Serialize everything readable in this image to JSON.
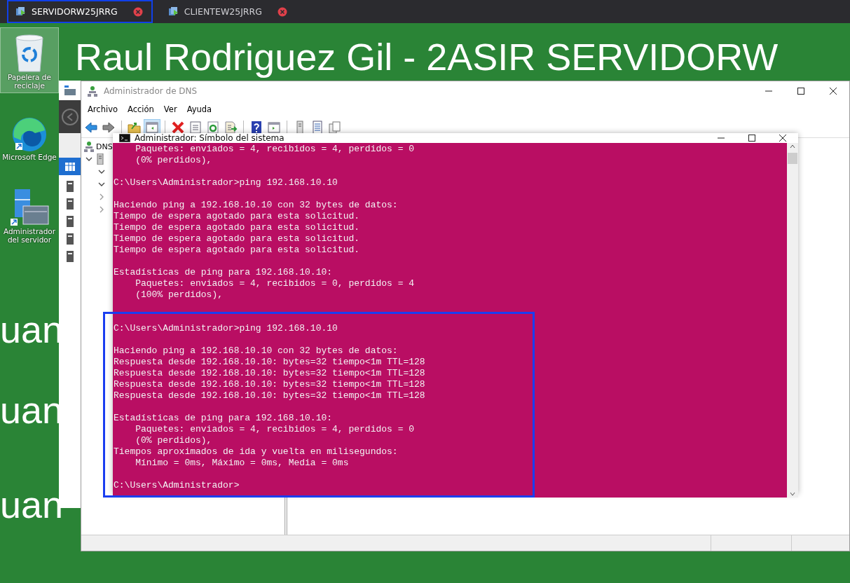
{
  "tabs": [
    {
      "label": "SERVIDORW25JRRG",
      "selected": true
    },
    {
      "label": "CLIENTEW25JRRG",
      "selected": false
    }
  ],
  "desktop": {
    "wallpaper_text": [
      "Raul Rodriguez Gil - 2ASIR SERVIDORW",
      "uan",
      "uan",
      "uan"
    ],
    "icons": [
      {
        "label": "Papelera de reciclaje",
        "kind": "recycle",
        "selected": true
      },
      {
        "label": "Microsoft Edge",
        "kind": "browser",
        "selected": false
      },
      {
        "label": "Administrador del servidor",
        "kind": "server",
        "selected": false
      }
    ]
  },
  "dns_window": {
    "title": "Administrador de DNS",
    "menu": [
      "Archivo",
      "Acción",
      "Ver",
      "Ayuda"
    ],
    "tree": {
      "label": "DNS",
      "children": [
        {
          "expanded": true,
          "children": [
            {
              "expanded": true
            },
            {
              "expanded": true
            },
            {
              "expanded": false
            },
            {
              "expanded": false
            }
          ]
        }
      ]
    }
  },
  "cmd_window": {
    "title": "Administrador: Símbolo del sistema",
    "blocks": [
      {
        "highlighted": false,
        "lines": [
          "    Paquetes: enviados = 4, recibidos = 4, perdidos = 0",
          "    (0% perdidos),"
        ]
      },
      {
        "highlighted": false,
        "lines": [
          "C:\\Users\\Administrador>ping 192.168.10.10"
        ]
      },
      {
        "highlighted": false,
        "lines": [
          "Haciendo ping a 192.168.10.10 con 32 bytes de datos:",
          "Tiempo de espera agotado para esta solicitud.",
          "Tiempo de espera agotado para esta solicitud.",
          "Tiempo de espera agotado para esta solicitud.",
          "Tiempo de espera agotado para esta solicitud."
        ]
      },
      {
        "highlighted": false,
        "lines": [
          "Estadísticas de ping para 192.168.10.10:",
          "    Paquetes: enviados = 4, recibidos = 0, perdidos = 4",
          "    (100% perdidos),"
        ]
      },
      {
        "highlighted": true,
        "lines": [
          "C:\\Users\\Administrador>ping 192.168.10.10"
        ]
      },
      {
        "highlighted": true,
        "lines": [
          "Haciendo ping a 192.168.10.10 con 32 bytes de datos:",
          "Respuesta desde 192.168.10.10: bytes=32 tiempo<1m TTL=128",
          "Respuesta desde 192.168.10.10: bytes=32 tiempo<1m TTL=128",
          "Respuesta desde 192.168.10.10: bytes=32 tiempo<1m TTL=128",
          "Respuesta desde 192.168.10.10: bytes=32 tiempo<1m TTL=128"
        ]
      },
      {
        "highlighted": true,
        "lines": [
          "Estadísticas de ping para 192.168.10.10:",
          "    Paquetes: enviados = 4, recibidos = 4, perdidos = 0",
          "    (0% perdidos),",
          "Tiempos aproximados de ida y vuelta en milisegundos:",
          "    Mínimo = 0ms, Máximo = 0ms, Media = 0ms"
        ]
      },
      {
        "highlighted": true,
        "lines": [
          "C:\\Users\\Administrador>"
        ]
      }
    ]
  }
}
